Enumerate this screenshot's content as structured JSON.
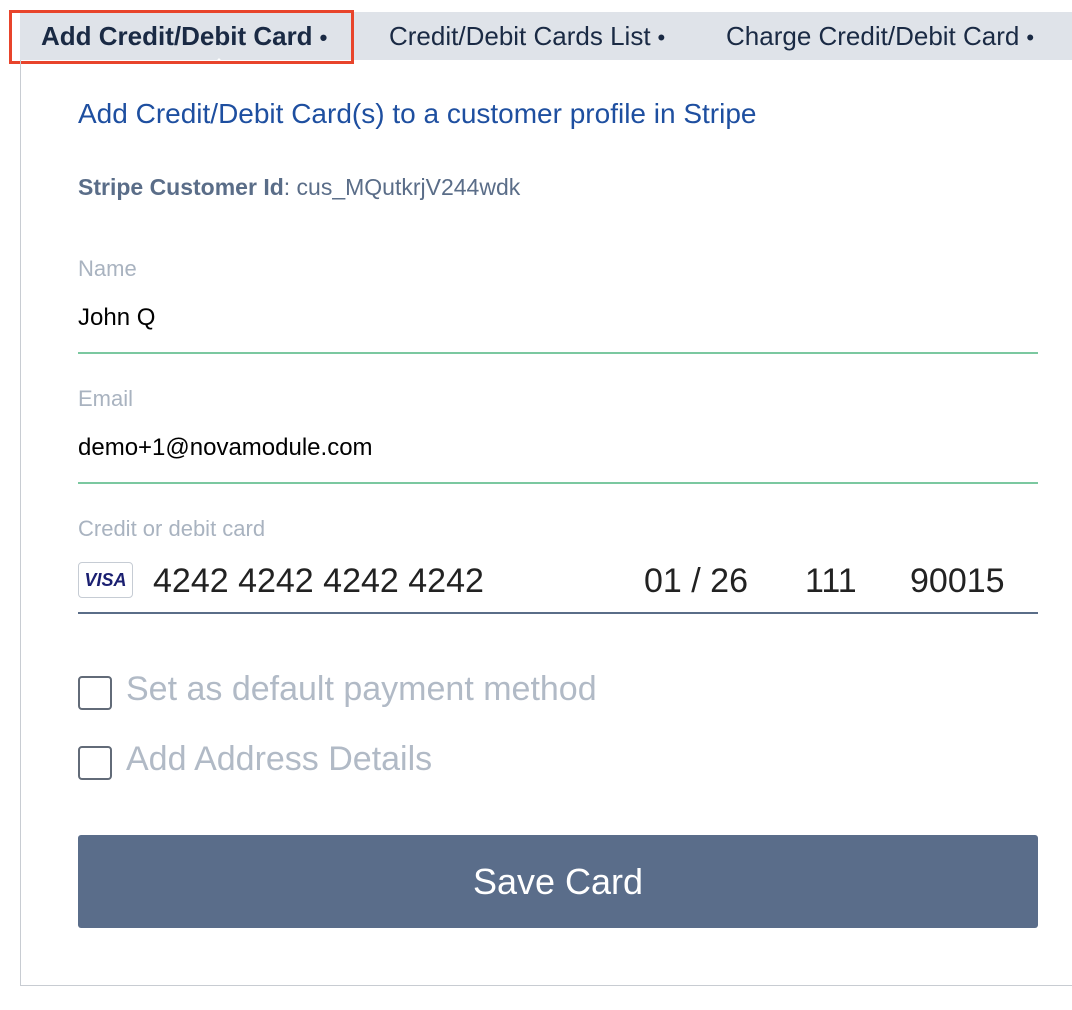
{
  "tabs": [
    {
      "label": "Add Credit/Debit Card",
      "active": true
    },
    {
      "label": "Credit/Debit Cards List",
      "active": false
    },
    {
      "label": "Charge Credit/Debit Card",
      "active": false
    }
  ],
  "tab_separator": "•",
  "heading": "Add Credit/Debit Card(s) to a customer profile in Stripe",
  "customer": {
    "label": "Stripe Customer Id",
    "separator": ":",
    "value": "cus_MQutkrjV244wdk"
  },
  "form": {
    "name_label": "Name",
    "name_value": "John Q",
    "email_label": "Email",
    "email_value": "demo+1@novamodule.com",
    "card_label": "Credit or debit card",
    "card_brand": "VISA",
    "card_number": "4242 4242 4242 4242",
    "card_expiry": "01 / 26",
    "card_cvc": "111",
    "card_zip": "90015",
    "default_label": "Set as default payment method",
    "default_checked": false,
    "address_label": "Add Address Details",
    "address_checked": false,
    "save_label": "Save Card"
  },
  "colors": {
    "accent_blue": "#1e4fa0",
    "button": "#5a6d8a",
    "field_underline": "#7bc8a0",
    "highlight_box": "#e8442b"
  }
}
